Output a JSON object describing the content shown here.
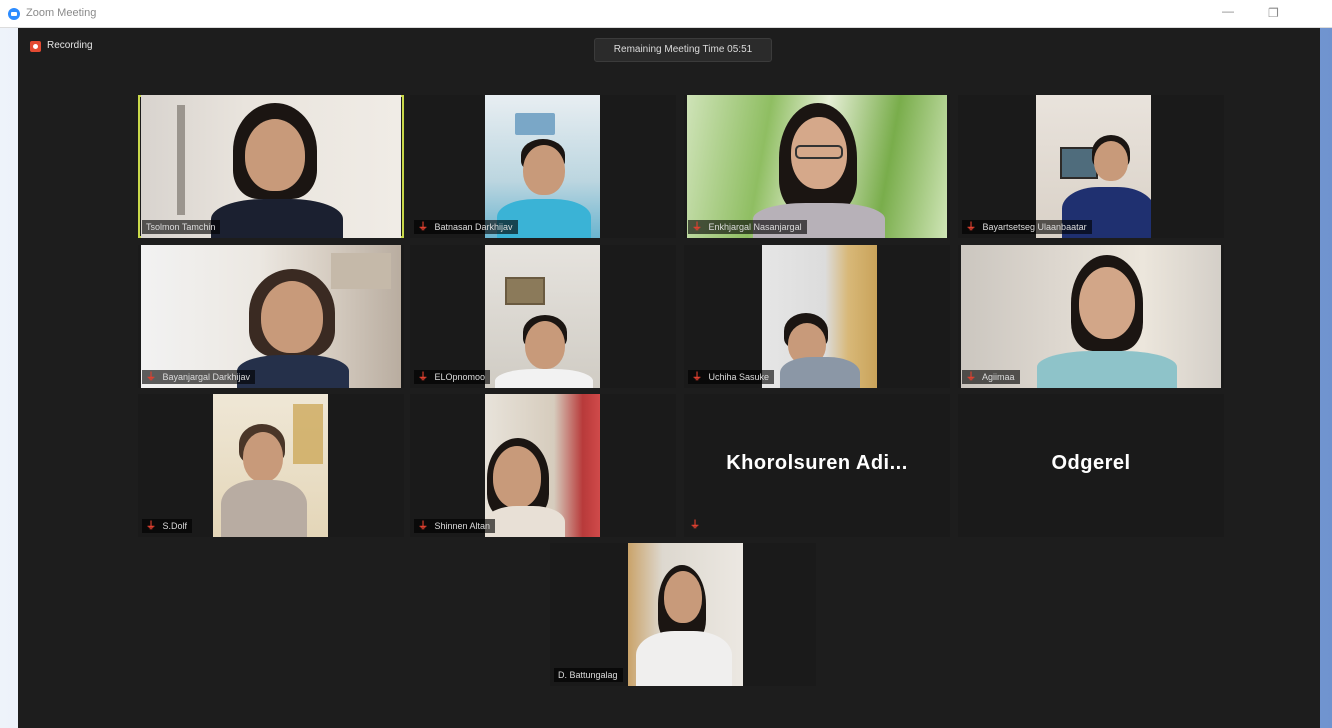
{
  "window": {
    "title": "Zoom Meeting",
    "minimize": "—",
    "restore": "❐"
  },
  "toolbar": {
    "recording_label": "Recording",
    "remaining_time": "Remaining Meeting Time 05:51"
  },
  "participants": [
    {
      "name": "Tsolmon Tamchin",
      "muted": false,
      "active_speaker": true
    },
    {
      "name": "Batnasan Darkhijav",
      "muted": true
    },
    {
      "name": "Enkhjargal Nasanjargal",
      "muted": true
    },
    {
      "name": "Bayartsetseg Ulaanbaatar",
      "muted": true
    },
    {
      "name": "Bayanjargal Darkhijav",
      "muted": true
    },
    {
      "name": "ELOpnomoo",
      "muted": true
    },
    {
      "name": "Uchiha Sasuke",
      "muted": true
    },
    {
      "name": "Agiimaa",
      "muted": true
    },
    {
      "name": "S.Dolf",
      "muted": true
    },
    {
      "name": "Shinnen Altan",
      "muted": true
    },
    {
      "name": "Khorolsuren  Adi...",
      "muted": true,
      "video": false
    },
    {
      "name": "Odgerel",
      "muted": false,
      "video": false
    },
    {
      "name": "D. Battungalag",
      "muted": false
    }
  ],
  "colors": {
    "muted": "#e0402f",
    "active_speaker_border": "#c9d94a",
    "recording": "#e34a32"
  }
}
